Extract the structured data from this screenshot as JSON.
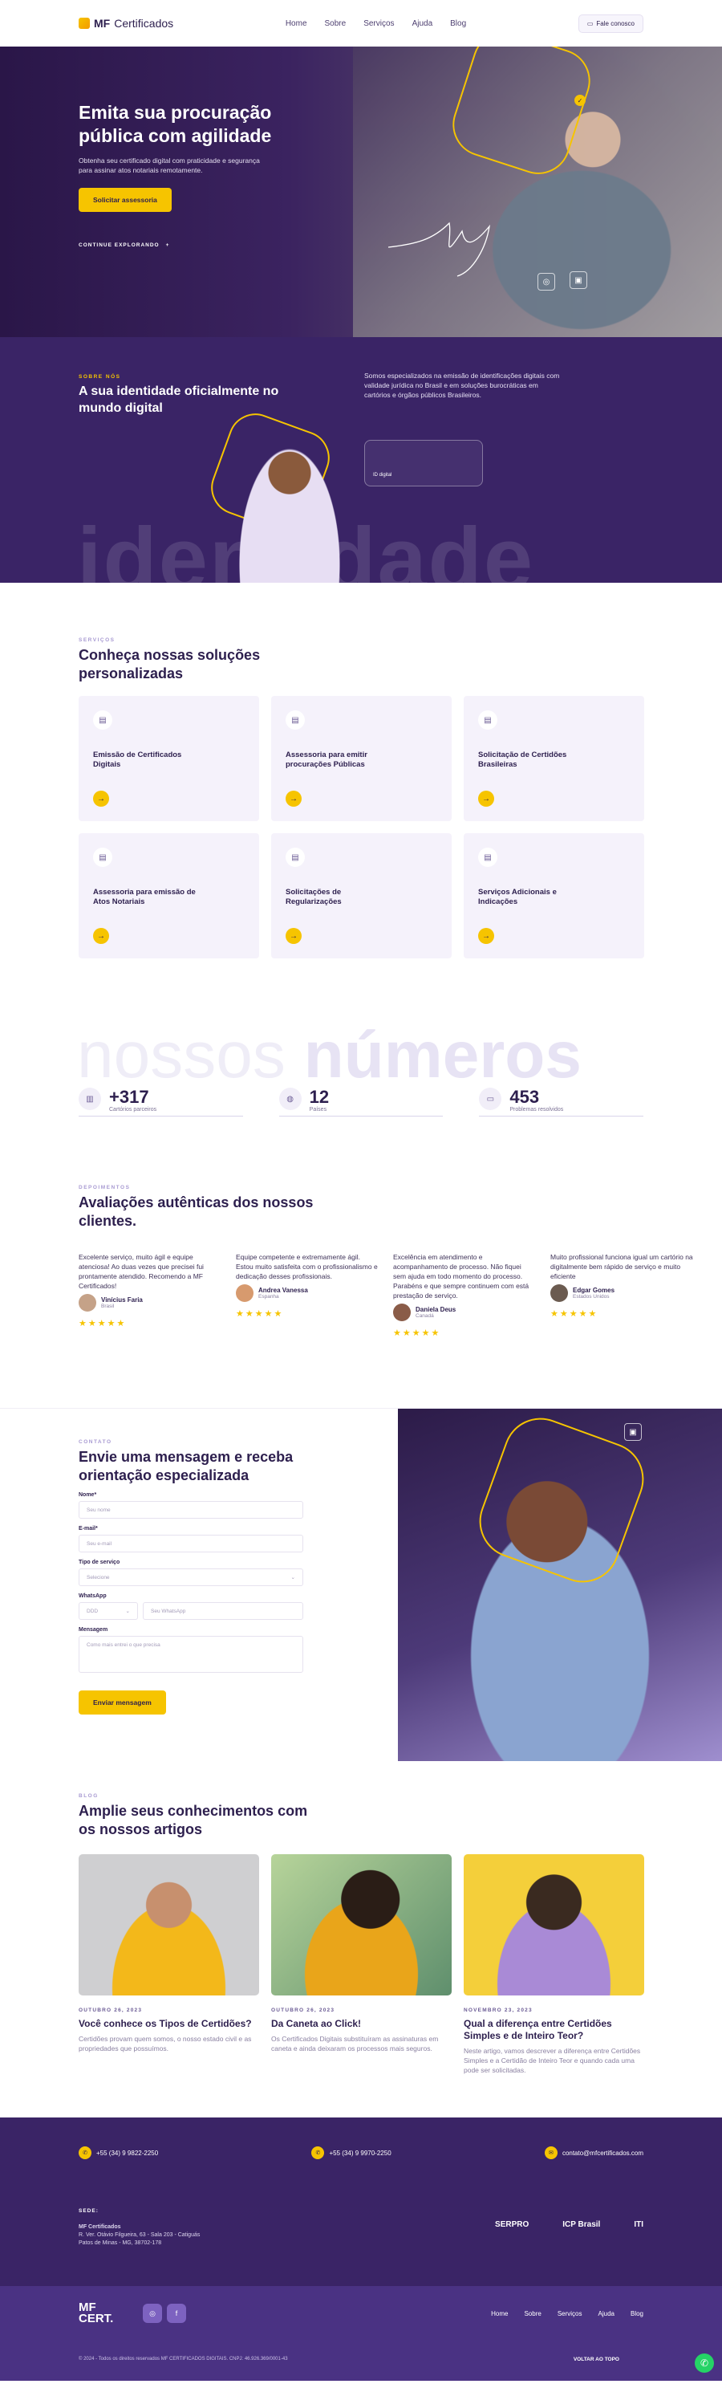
{
  "header": {
    "logo_mf": "MF",
    "logo_cert": "Certificados",
    "nav": [
      "Home",
      "Sobre",
      "Serviços",
      "Ajuda",
      "Blog"
    ],
    "cta": "Fale conosco"
  },
  "hero": {
    "title": "Emita sua procuração pública com agilidade",
    "text": "Obtenha seu certificado digital com praticidade e segurança para assinar atos notariais remotamente.",
    "button": "Solicitar assessoria",
    "explore": "CONTINUE EXPLORANDO"
  },
  "about": {
    "eyebrow": "SOBRE NÓS",
    "title": "A sua identidade oficialmente no mundo digital",
    "text": "Somos especializados na emissão de identificações digitais com validade jurídica no Brasil e em soluções burocráticas em cartórios e órgãos públicos Brasileiros.",
    "card_label": "ID digital",
    "big_word": "identidade"
  },
  "services": {
    "eyebrow": "SERVIÇOS",
    "title": "Conheça nossas soluções personalizadas",
    "items": [
      "Emissão de Certificados Digitais",
      "Assessoria para emitir procurações Públicas",
      "Solicitação de Certidões Brasileiras",
      "Assessoria para emissão de Atos Notariais",
      "Solicitações de Regularizações",
      "Serviços Adicionais e Indicações"
    ]
  },
  "numbers": {
    "big_light": "nossos",
    "big_bold": "números",
    "stats": [
      {
        "value": "+317",
        "label": "Cartórios parceiros"
      },
      {
        "value": "12",
        "label": "Países"
      },
      {
        "value": "453",
        "label": "Problemas resolvidos"
      }
    ]
  },
  "testimonials": {
    "eyebrow": "DEPOIMENTOS",
    "title": "Avaliações autênticas dos nossos clientes.",
    "items": [
      {
        "quote": "Excelente serviço, muito ágil e equipe atenciosa! Ao duas vezes que precisei fui prontamente atendido. Recomendo a MF Certificados!",
        "name": "Vinícius Faria",
        "place": "Brasil"
      },
      {
        "quote": "Equipe competente e extremamente ágil. Estou muito satisfeita com o profissionalismo e dedicação desses profissionais.",
        "name": "Andrea Vanessa",
        "place": "Espanha"
      },
      {
        "quote": "Excelência em atendimento e acompanhamento de processo. Não fiquei sem ajuda em todo momento do processo. Parabéns e que sempre continuem com está prestação de serviço.",
        "name": "Daniela Deus",
        "place": "Canadá"
      },
      {
        "quote": "Muito profissional funciona igual um cartório na digitalmente bem rápido de serviço e muito eficiente",
        "name": "Edgar Gomes",
        "place": "Estados Unidos"
      }
    ],
    "stars": "★★★★★"
  },
  "contact": {
    "eyebrow": "CONTATO",
    "title": "Envie uma mensagem e receba orientação especializada",
    "name_label": "Nome*",
    "name_ph": "Seu nome",
    "email_label": "E-mail*",
    "email_ph": "Seu e-mail",
    "service_label": "Tipo de serviço",
    "service_value": "Selecione",
    "whatsapp_label": "WhatsApp",
    "ddd_value": "DDD",
    "whatsapp_ph": "Seu WhatsApp",
    "message_label": "Mensagem",
    "message_ph": "Como mais entrei o que precisa",
    "button": "Enviar mensagem"
  },
  "blog": {
    "eyebrow": "BLOG",
    "title": "Amplie seus conhecimentos com os nossos artigos",
    "posts": [
      {
        "date": "OUTUBRO 26, 2023",
        "title": "Você conhece os Tipos de Certidões?",
        "excerpt": "Certidões provam quem somos, o nosso estado civil e as propriedades que possuímos."
      },
      {
        "date": "OUTUBRO 26, 2023",
        "title": "Da Caneta ao Click!",
        "excerpt": "Os Certificados Digitais substituíram as assinaturas em caneta e ainda deixaram os processos mais seguros."
      },
      {
        "date": "NOVEMBRO 23, 2023",
        "title": "Qual a diferença entre Certidões Simples e de Inteiro Teor?",
        "excerpt": "Neste artigo, vamos descrever a diferença entre Certidões Simples e a Certidão de Inteiro Teor e quando cada uma pode ser solicitadas."
      }
    ]
  },
  "footer": {
    "phone1": "+55 (34) 9 9822-2250",
    "phone2": "+55 (34) 9 9970-2250",
    "email": "contato@mfcertificados.com",
    "sede_title": "SEDE:",
    "sede_name": "MF Certificados",
    "sede_addr1": "R. Ver. Otávio Filgueira, 63 - Sala 203 - Catiguás",
    "sede_addr2": "Patos de Minas - MG, 38702-178",
    "seals": [
      "SERPRO",
      "ICP Brasil",
      "ITI"
    ],
    "logo_top": "MF",
    "logo_bottom": "CERT.",
    "nav": [
      "Home",
      "Sobre",
      "Serviços",
      "Ajuda",
      "Blog"
    ],
    "copyright": "© 2024 - Todos os direitos reservados MF CERTIFICADOS DIGITAIS. CNPJ: 46.926.369/0001-43",
    "back_to_top": "VOLTAR AO TOPO"
  },
  "colors": {
    "primary": "#3a2466",
    "accent": "#f6c400"
  }
}
